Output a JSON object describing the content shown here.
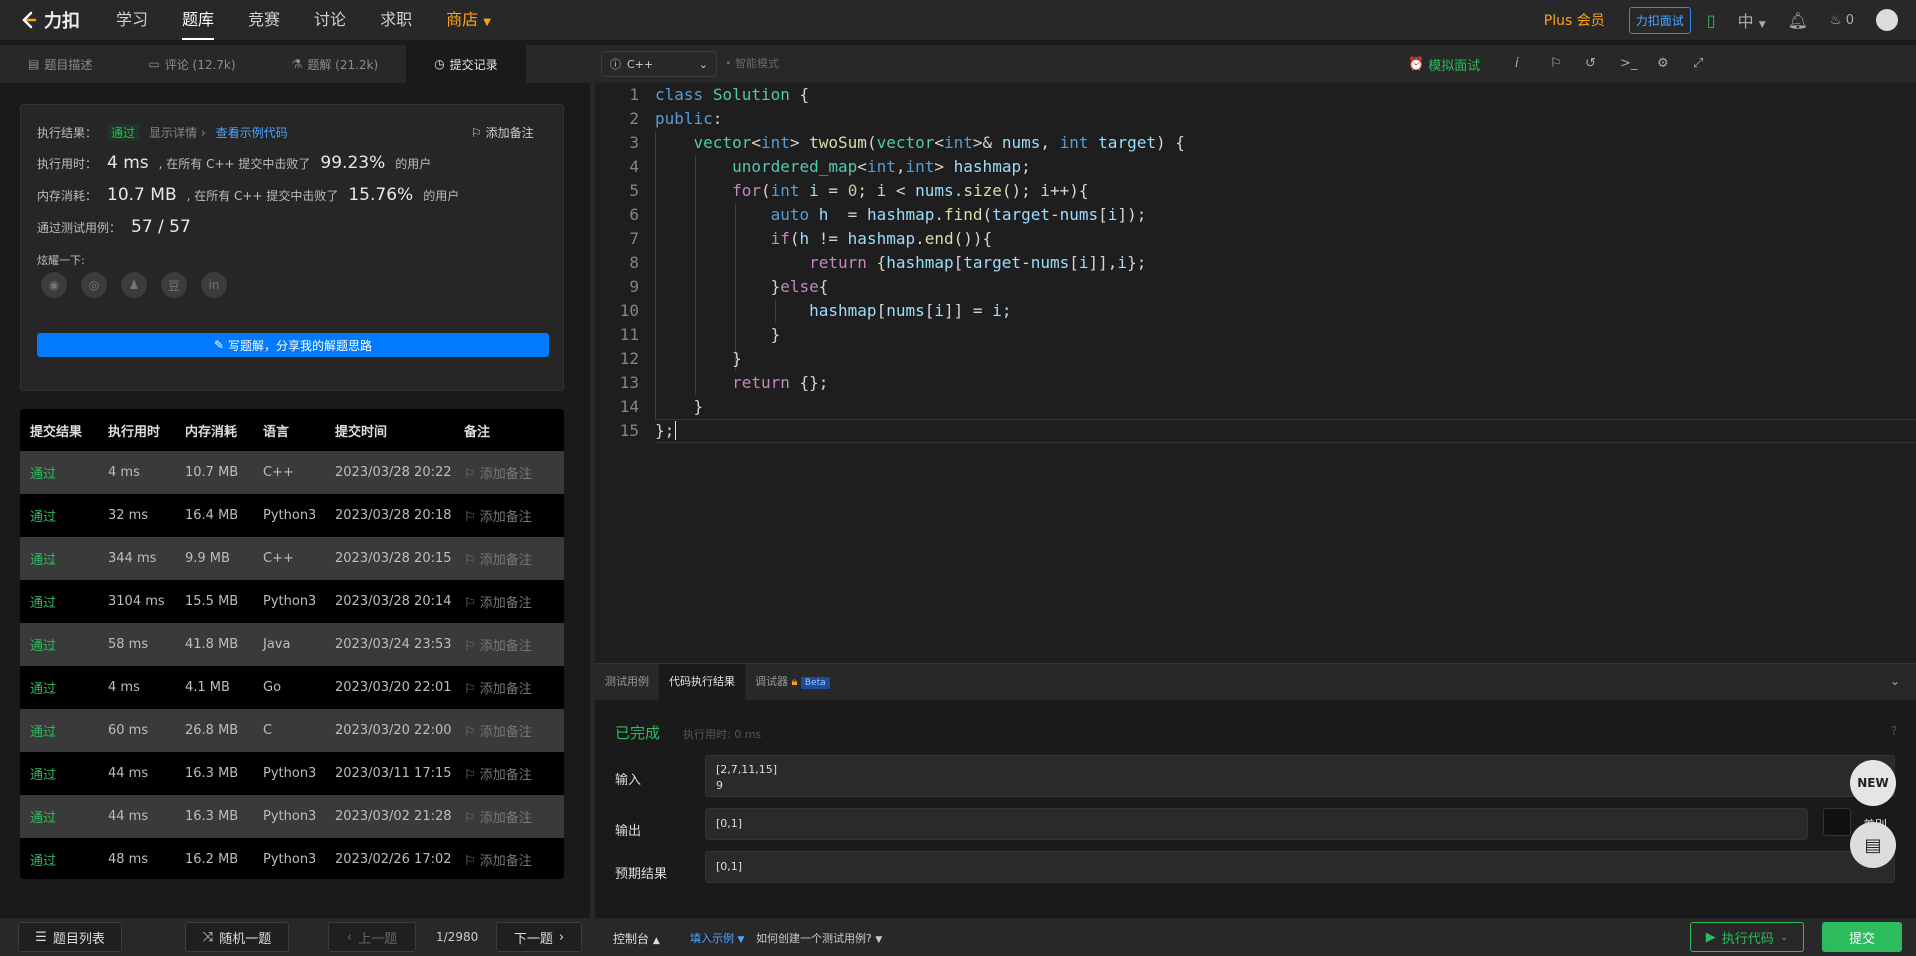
{
  "nav": {
    "brand": "力扣",
    "links": [
      "学习",
      "题库",
      "竞赛",
      "讨论",
      "求职",
      "商店"
    ],
    "plus_label": "Plus 会员",
    "interview_label": "力扣面试",
    "lang_label": "中",
    "points": "0"
  },
  "left_tabs": [
    {
      "label": "题目描述",
      "icon": "doc-icon"
    },
    {
      "label": "评论 (12.7k)",
      "icon": "comment-icon"
    },
    {
      "label": "题解 (21.2k)",
      "icon": "flask-icon"
    },
    {
      "label": "提交记录",
      "icon": "clock-icon"
    }
  ],
  "result": {
    "label_result": "执行结果：",
    "status": "通过",
    "show_detail": "显示详情 ›",
    "view_sample": "查看示例代码",
    "add_note": "添加备注",
    "label_time": "执行用时：",
    "time_value": "4 ms",
    "time_mid": ", 在所有 C++ 提交中击败了",
    "time_pct": "99.23%",
    "users": "的用户",
    "label_mem": "内存消耗：",
    "mem_value": "10.7 MB",
    "mem_mid": ", 在所有 C++ 提交中击败了",
    "mem_pct": "15.76%",
    "label_cases": "通过测试用例：",
    "cases_value": "57 / 57",
    "share_label": "炫耀一下:",
    "share_icons": [
      "wechat-icon",
      "weibo-icon",
      "qq-icon",
      "douban-icon",
      "linkedin-icon"
    ],
    "write_btn": "写题解，分享我的解题思路"
  },
  "table": {
    "headers": [
      "提交结果",
      "执行用时",
      "内存消耗",
      "语言",
      "提交时间",
      "备注"
    ],
    "note_label": "添加备注",
    "rows": [
      {
        "status": "通过",
        "time": "4 ms",
        "mem": "10.7 MB",
        "lang": "C++",
        "date": "2023/03/28 20:22"
      },
      {
        "status": "通过",
        "time": "32 ms",
        "mem": "16.4 MB",
        "lang": "Python3",
        "date": "2023/03/28 20:18"
      },
      {
        "status": "通过",
        "time": "344 ms",
        "mem": "9.9 MB",
        "lang": "C++",
        "date": "2023/03/28 20:15"
      },
      {
        "status": "通过",
        "time": "3104 ms",
        "mem": "15.5 MB",
        "lang": "Python3",
        "date": "2023/03/28 20:14"
      },
      {
        "status": "通过",
        "time": "58 ms",
        "mem": "41.8 MB",
        "lang": "Java",
        "date": "2023/03/24 23:53"
      },
      {
        "status": "通过",
        "time": "4 ms",
        "mem": "4.1 MB",
        "lang": "Go",
        "date": "2023/03/20 22:01"
      },
      {
        "status": "通过",
        "time": "60 ms",
        "mem": "26.8 MB",
        "lang": "C",
        "date": "2023/03/20 22:00"
      },
      {
        "status": "通过",
        "time": "44 ms",
        "mem": "16.3 MB",
        "lang": "Python3",
        "date": "2023/03/11 17:15"
      },
      {
        "status": "通过",
        "time": "44 ms",
        "mem": "16.3 MB",
        "lang": "Python3",
        "date": "2023/03/02 21:28"
      },
      {
        "status": "通过",
        "time": "48 ms",
        "mem": "16.2 MB",
        "lang": "Python3",
        "date": "2023/02/26 17:02"
      }
    ]
  },
  "bottom_left": {
    "list_btn": "题目列表",
    "random_btn": "随机一题",
    "prev_btn": "上一题",
    "page": "1/2980",
    "next_btn": "下一题"
  },
  "editor": {
    "language": "C++",
    "smart_mode": "智能模式",
    "mock_interview": "模拟面试",
    "line_numbers": [
      "1",
      "2",
      "3",
      "4",
      "5",
      "6",
      "7",
      "8",
      "9",
      "10",
      "11",
      "12",
      "13",
      "14",
      "15"
    ]
  },
  "bottom_panel": {
    "tabs": [
      "测试用例",
      "代码执行结果",
      "调试器"
    ],
    "beta": "Beta",
    "status": "已完成",
    "exec_time": "执行用时: 0 ms",
    "input_label": "输入",
    "input_value": "[2,7,11,15]\n9",
    "output_label": "输出",
    "output_value": "[0,1]",
    "expected_label": "预期结果",
    "expected_value": "[0,1]",
    "diff_label": "差别",
    "new_badge": "NEW"
  },
  "bottom_right": {
    "console": "控制台",
    "fill_sample": "填入示例",
    "how_create": "如何创建一个测试用例?",
    "run_btn": "执行代码",
    "submit_btn": "提交"
  },
  "colors": {
    "accent_green": "#2cbb5d",
    "accent_orange": "#ffa116",
    "accent_blue": "#007aff"
  }
}
